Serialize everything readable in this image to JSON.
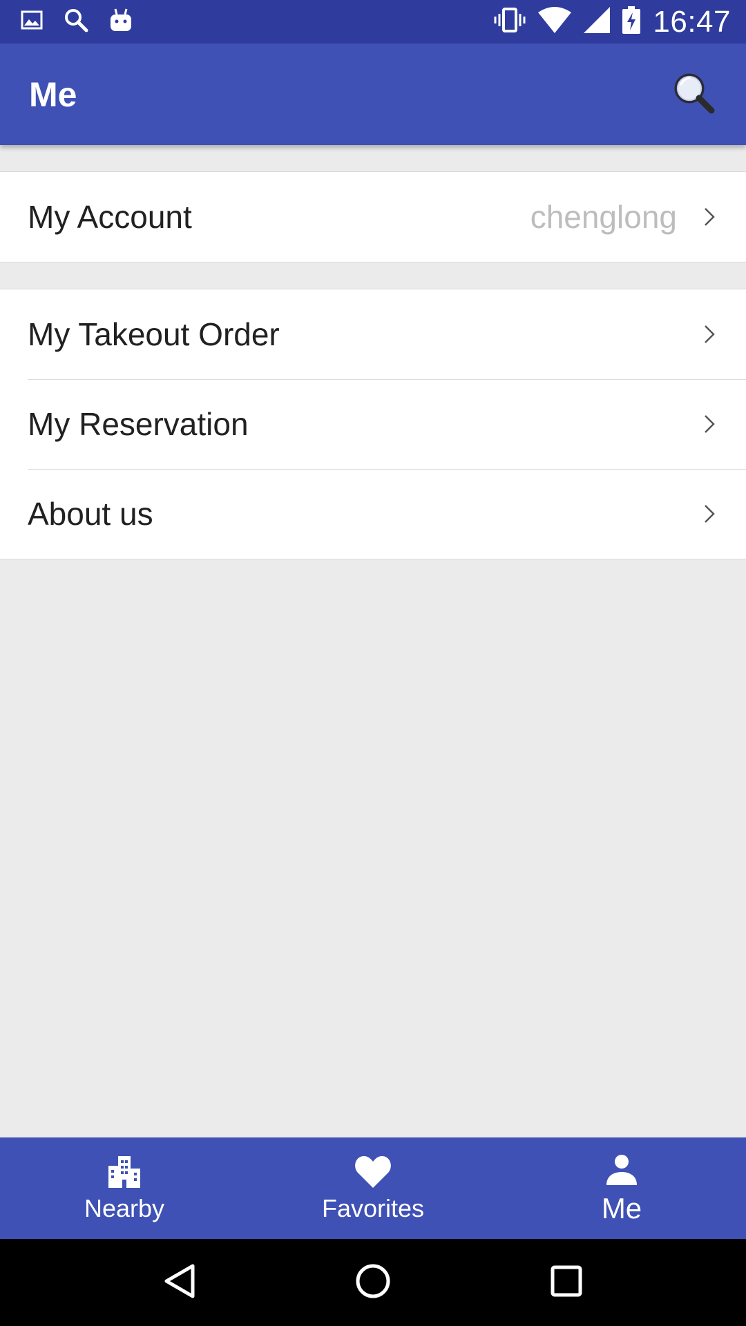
{
  "status_bar": {
    "time": "16:47",
    "left_icons": [
      "image-icon",
      "search-icon",
      "android-icon"
    ],
    "right_icons": [
      "vibrate-icon",
      "wifi-icon",
      "signal-icon",
      "battery-charging-icon"
    ]
  },
  "app_bar": {
    "title": "Me",
    "search_icon": "search-icon"
  },
  "groups": [
    {
      "rows": [
        {
          "label": "My Account",
          "value": "chenglong"
        }
      ]
    },
    {
      "rows": [
        {
          "label": "My Takeout Order",
          "value": ""
        },
        {
          "label": "My Reservation",
          "value": ""
        },
        {
          "label": "About us",
          "value": ""
        }
      ]
    }
  ],
  "bottom_nav": {
    "items": [
      {
        "label": "Nearby",
        "icon": "city-icon",
        "active": false
      },
      {
        "label": "Favorites",
        "icon": "heart-icon",
        "active": false
      },
      {
        "label": "Me",
        "icon": "person-icon",
        "active": true
      }
    ]
  },
  "system_nav": {
    "items": [
      "back-icon",
      "home-icon",
      "recents-icon"
    ]
  },
  "colors": {
    "primary": "#3f51b5",
    "primary_dark": "#2f3c9e",
    "background": "#ebebeb",
    "secondary_text": "#bdbdbd"
  }
}
